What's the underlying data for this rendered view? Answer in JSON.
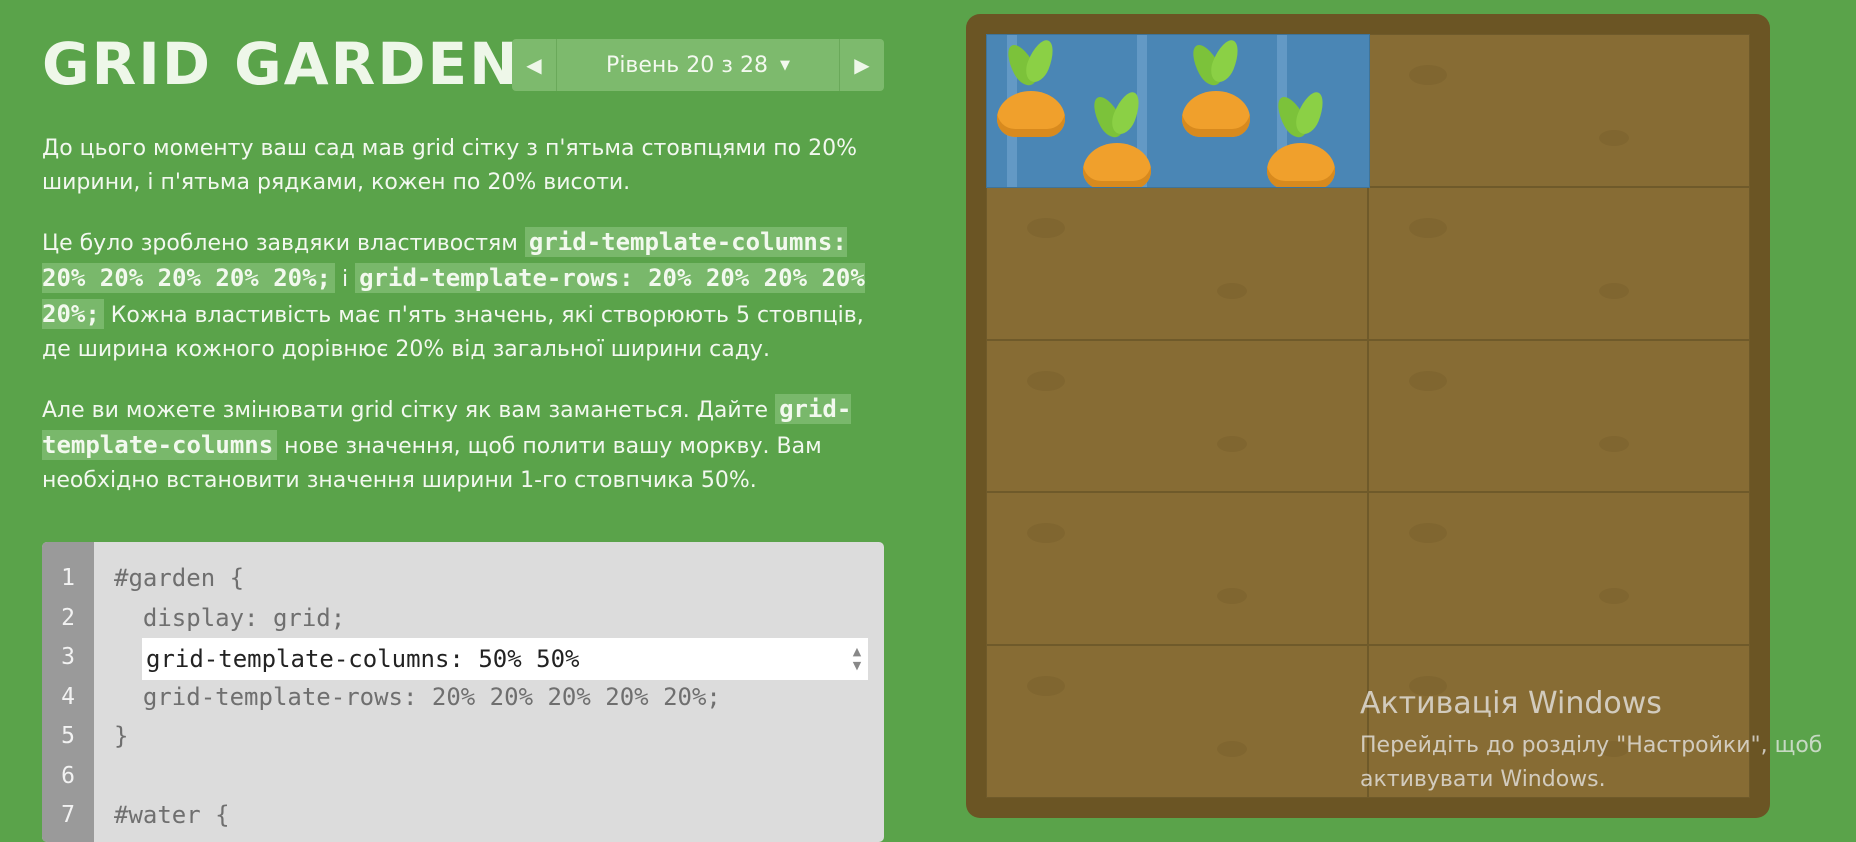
{
  "header": {
    "title": "GRID GARDEN",
    "level_label": "Рівень 20 з 28",
    "prev_icon": "◀",
    "next_icon": "▶",
    "caret_icon": "▼"
  },
  "instructions": {
    "p1": "До цього моменту ваш сад мав grid сітку з п'ятьма стовпцями по 20% ширини, і п'ятьма рядками, кожен по 20% висоти.",
    "p2_a": "Це було зроблено завдяки властивостям ",
    "p2_code1": "grid-template-columns: 20% 20% 20% 20% 20%;",
    "p2_b": " і ",
    "p2_code2": "grid-template-rows: 20% 20% 20% 20% 20%;",
    "p2_c": " Кожна властивість має п'ять значень, які створюють 5 стовпців, де ширина кожного дорівнює 20% від загальної ширини саду.",
    "p3_a": "Але ви можете змінювати grid сітку як вам заманеться. Дайте ",
    "p3_code": "grid-template-columns",
    "p3_b": " нове значення, щоб полити вашу моркву. Вам необхідно встановити значення ширини 1-го стовпчика 50%."
  },
  "editor": {
    "line_numbers": [
      "1",
      "2",
      "3",
      "4",
      "5",
      "6",
      "7"
    ],
    "lines": [
      "#garden {",
      "  display: grid;",
      "",
      "  grid-template-rows: 20% 20% 20% 20% 20%;",
      "}",
      "",
      "#water {"
    ],
    "input_value": "grid-template-columns: 50% 50%"
  },
  "watermark": {
    "title": "Активація Windows",
    "subtitle": "Перейдіть до розділу \"Настройки\", щоб активувати Windows."
  },
  "colors": {
    "background": "#5aa34a",
    "soil": "#876c34",
    "water": "#4a86b5",
    "carrot": "#f0a02c"
  }
}
